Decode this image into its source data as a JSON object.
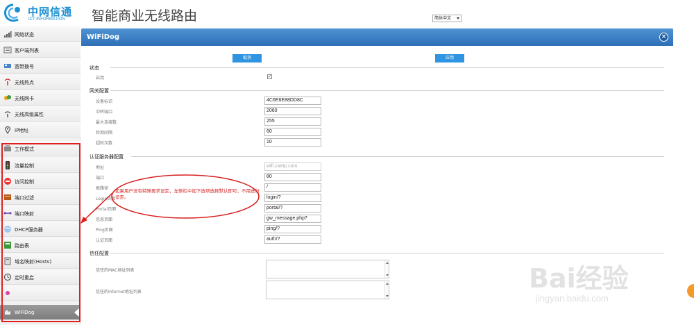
{
  "brand": {
    "logo_name": "中网信通",
    "logo_sub": "ICT INFORMATION",
    "app_title": "智能商业无线路由",
    "accent_color": "#1a8fd1"
  },
  "language_select": {
    "value": "简体中文"
  },
  "sidebar": {
    "items": [
      {
        "label": "网络状态",
        "icon": "signal-bars-icon"
      },
      {
        "label": "客户端列表",
        "icon": "client-list-icon"
      },
      {
        "label": "宽带拨号",
        "icon": "broadband-icon"
      },
      {
        "label": "无线热点",
        "icon": "hotspot-icon"
      },
      {
        "label": "无线网卡",
        "icon": "wireless-card-icon"
      },
      {
        "label": "无线高级属性",
        "icon": "wireless-advanced-icon"
      },
      {
        "label": "IP地址",
        "icon": "location-pin-icon"
      },
      {
        "label": "工作模式",
        "icon": "work-mode-icon"
      },
      {
        "label": "流量控制",
        "icon": "traffic-light-icon"
      },
      {
        "label": "访问控制",
        "icon": "no-entry-icon"
      },
      {
        "label": "端口过滤",
        "icon": "port-filter-icon"
      },
      {
        "label": "端口映射",
        "icon": "port-mapping-icon"
      },
      {
        "label": "DHCP服务器",
        "icon": "dhcp-server-icon"
      },
      {
        "label": "路由表",
        "icon": "route-table-icon"
      },
      {
        "label": "域名映射(Hosts)",
        "icon": "hosts-icon"
      },
      {
        "label": "定时重启",
        "icon": "timer-restart-icon"
      },
      {
        "label": "",
        "icon": "misc-icon"
      },
      {
        "label": "WiFiDog",
        "icon": "wifidog-icon",
        "active": true
      }
    ]
  },
  "panel": {
    "title": "WiFiDog",
    "cancel_label": "取消",
    "apply_label": "应用"
  },
  "status_section": {
    "title": "状态",
    "enable_label": "启用",
    "enabled": true,
    "check_glyph": "✓"
  },
  "gateway_section": {
    "title": "网关配置",
    "fields": [
      {
        "label": "设备标识",
        "value": "4C6E6E88DD8C"
      },
      {
        "label": "中转端口",
        "value": "2060"
      },
      {
        "label": "最大连接数",
        "value": "255"
      },
      {
        "label": "检测间隔",
        "value": "60"
      },
      {
        "label": "超时次数",
        "value": "10"
      }
    ]
  },
  "auth_section": {
    "title": "认证服务器配置",
    "fields": [
      {
        "label": "地址",
        "value": "wifi.caetp.com"
      },
      {
        "label": "端口",
        "value": "80"
      },
      {
        "label": "根路径",
        "value": "/"
      },
      {
        "label": "Login页面",
        "value": "login/?"
      },
      {
        "label": "Portal页面",
        "value": "portal/?"
      },
      {
        "label": "信息页面",
        "value": "gw_message.php?"
      },
      {
        "label": "Ping页面",
        "value": "ping/?"
      },
      {
        "label": "认证页面",
        "value": "auth/?"
      }
    ]
  },
  "trust_section": {
    "title": "信任配置",
    "mac_label": "信任的MAC地址列表",
    "internet_label": "信任的Internet地址列表"
  },
  "annotation": {
    "text": "如果用户没有特殊要求设定，左侧栏中如下选项选择默认即可，不用进行设定。",
    "color": "#d81e1e"
  },
  "watermark": {
    "text": "Bai经验",
    "sub": "jingyan.baidu.com"
  }
}
